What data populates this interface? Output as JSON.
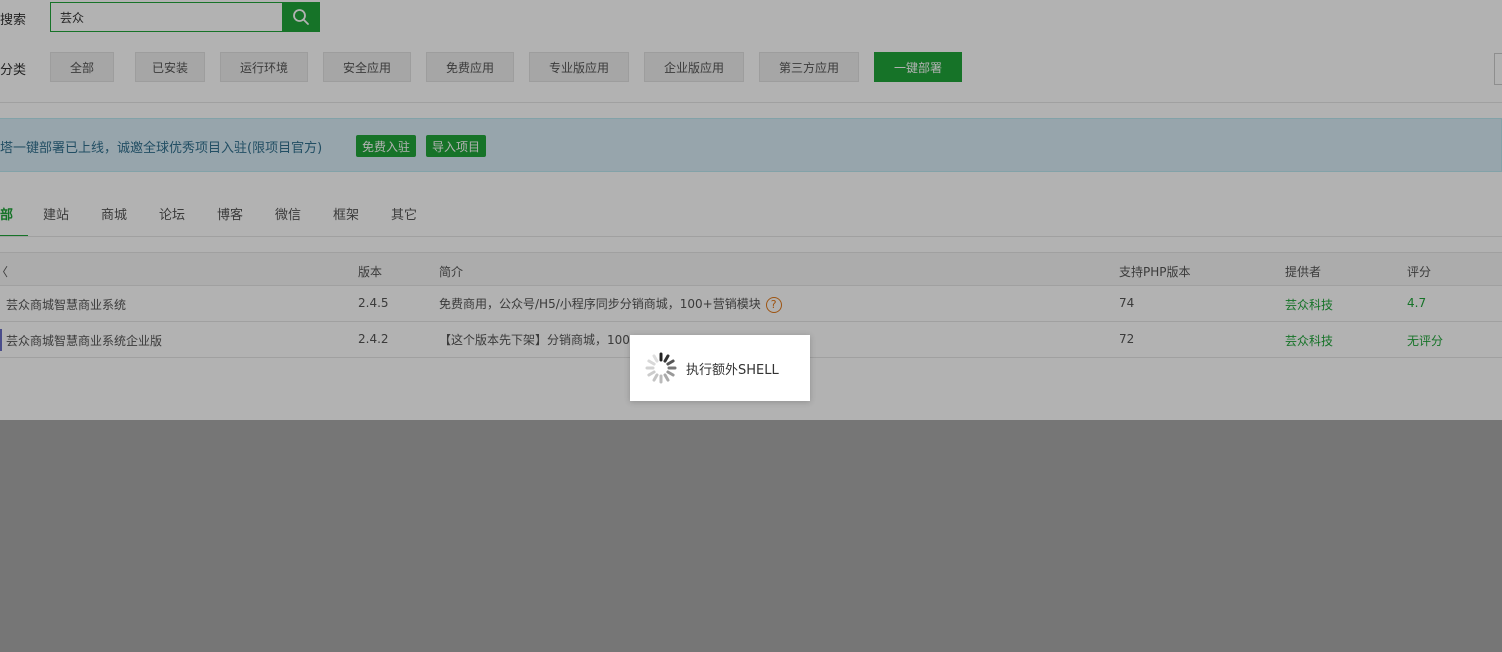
{
  "search": {
    "label": "搜索",
    "value": "芸众"
  },
  "category": {
    "label": "分类",
    "buttons": [
      "全部",
      "已安装",
      "运行环境",
      "安全应用",
      "免费应用",
      "专业版应用",
      "企业版应用",
      "第三方应用",
      "一键部署"
    ]
  },
  "banner": {
    "text": "塔一键部署已上线，诚邀全球优秀项目入驻(限项目官方)",
    "btn_join": "免费入驻",
    "btn_import": "导入项目"
  },
  "tabs": [
    "部",
    "建站",
    "商城",
    "论坛",
    "博客",
    "微信",
    "框架",
    "其它"
  ],
  "table": {
    "headers": {
      "name": "〈",
      "version": "版本",
      "desc": "简介",
      "php": "支持PHP版本",
      "provider": "提供者",
      "score": "评分"
    },
    "rows": [
      {
        "name": "芸众商城智慧商业系统",
        "version": "2.4.5",
        "desc": "免费商用，公众号/H5/小程序同步分销商城，100+营销模块",
        "php": "74",
        "provider": "芸众科技",
        "score": "4.7"
      },
      {
        "name": "芸众商城智慧商业系统企业版",
        "version": "2.4.2",
        "desc": "【这个版本先下架】分销商城，100",
        "php": "72",
        "provider": "芸众科技",
        "score": "无评分"
      }
    ]
  },
  "loading": {
    "text": "执行额外SHELL"
  },
  "colors": {
    "accent": "#20a53a",
    "banner_bg": "#d9edf7",
    "banner_text": "#31708f",
    "help_icon": "#e27a1c"
  }
}
